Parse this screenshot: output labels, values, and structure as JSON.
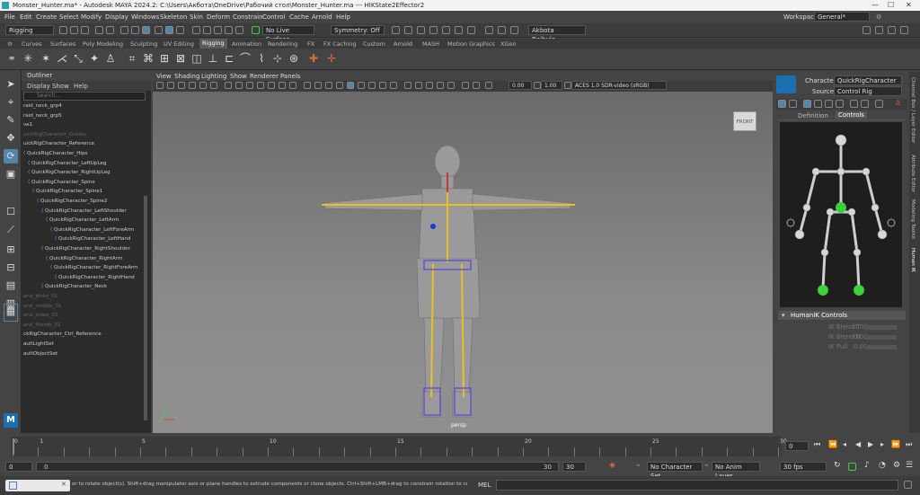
{
  "window": {
    "title": "Monster_Hunter.ma* - Autodesk MAYA 2024.2: C:\\Users\\Акбота\\OneDrive\\Рабочий стол\\Monster_Hunter.ma    ---    HIKState2Effector2"
  },
  "menubar": [
    "File",
    "Edit",
    "Create",
    "Select",
    "Modify",
    "Display",
    "Windows",
    "Skeleton",
    "Skin",
    "Deform",
    "Constrain",
    "Control",
    "Cache",
    "Arnold",
    "Help"
  ],
  "workspace": {
    "label": "Workspace:",
    "value": "General*"
  },
  "statusline": {
    "menuset": "Rigging",
    "live_surface": "No Live Surface",
    "symmetry": "Symmetry: Off",
    "user": "Akbota Baibulo..."
  },
  "shelf_tabs": [
    "Curves",
    "Surfaces",
    "Poly Modeling",
    "Sculpting",
    "UV Editing",
    "Rigging",
    "Animation",
    "Rendering",
    "FX",
    "FX Caching",
    "Custom",
    "Arnold",
    "MASH",
    "Motion Graphics",
    "XGen"
  ],
  "active_shelf_tab": "Rigging",
  "outliner": {
    "title": "Outliner",
    "menu": [
      "Display",
      "Show",
      "Help"
    ],
    "search_placeholder": "Search...",
    "items": [
      {
        "label": "raid_neck_grp4",
        "dim": false,
        "depth": 0
      },
      {
        "label": "raid_neck_grp5",
        "dim": false,
        "depth": 0
      },
      {
        "label": "ve1",
        "dim": false,
        "depth": 0
      },
      {
        "label": "uickRigCharacter_Guides",
        "dim": true,
        "depth": 0
      },
      {
        "label": "uickRigCharacter_Reference",
        "dim": false,
        "depth": 0
      },
      {
        "label": "QuickRigCharacter_Hips",
        "dim": false,
        "depth": 0,
        "joint": true
      },
      {
        "label": "QuickRigCharacter_LeftUpLeg",
        "dim": false,
        "depth": 1,
        "joint": true
      },
      {
        "label": "QuickRigCharacter_RightUpLeg",
        "dim": false,
        "depth": 1,
        "joint": true
      },
      {
        "label": "QuickRigCharacter_Spine",
        "dim": false,
        "depth": 1,
        "joint": true
      },
      {
        "label": "QuickRigCharacter_Spine1",
        "dim": false,
        "depth": 2,
        "joint": true
      },
      {
        "label": "QuickRigCharacter_Spine2",
        "dim": false,
        "depth": 3,
        "joint": true
      },
      {
        "label": "QuickRigCharacter_LeftShoulder",
        "dim": false,
        "depth": 4,
        "joint": true
      },
      {
        "label": "QuickRigCharacter_LeftArm",
        "dim": false,
        "depth": 5,
        "joint": true
      },
      {
        "label": "QuickRigCharacter_LeftForeArm",
        "dim": false,
        "depth": 6,
        "joint": true
      },
      {
        "label": "QuickRigCharacter_LeftHand",
        "dim": false,
        "depth": 7,
        "joint": true
      },
      {
        "label": "QuickRigCharacter_RightShoulder",
        "dim": false,
        "depth": 4,
        "joint": true
      },
      {
        "label": "QuickRigCharacter_RightArm",
        "dim": false,
        "depth": 5,
        "joint": true
      },
      {
        "label": "QuickRigCharacter_RightForeArm",
        "dim": false,
        "depth": 6,
        "joint": true
      },
      {
        "label": "QuickRigCharacter_RightHand",
        "dim": false,
        "depth": 7,
        "joint": true
      },
      {
        "label": "QuickRigCharacter_Neck",
        "dim": false,
        "depth": 4,
        "joint": true
      },
      {
        "label": "and_pinky_01",
        "dim": true,
        "depth": 0
      },
      {
        "label": "and_middle_01",
        "dim": true,
        "depth": 0
      },
      {
        "label": "and_index_01",
        "dim": true,
        "depth": 0
      },
      {
        "label": "and_thumb_01",
        "dim": true,
        "depth": 0
      },
      {
        "label": "ckRigCharacter_Ctrl_Reference",
        "dim": false,
        "depth": 0
      },
      {
        "label": "aultLightSet",
        "dim": false,
        "depth": 0
      },
      {
        "label": "aultObjectSet",
        "dim": false,
        "depth": 0
      }
    ]
  },
  "viewport": {
    "menu": [
      "View",
      "Shading",
      "Lighting",
      "Show",
      "Renderer",
      "Panels"
    ],
    "exposure": "0.00",
    "gamma": "1.00",
    "colorspace": "ACES 1.0 SDR-video (sRGB)",
    "camera_label": "persp",
    "viewcube": "FRONT"
  },
  "hik": {
    "character_label": "Character:",
    "character_value": "QuickRigCharacter",
    "source_label": "Source:",
    "source_value": "Control Rig",
    "tabs": [
      "Definition",
      "Controls"
    ],
    "active_tab": "Controls",
    "section": "HumanIK Controls",
    "props": [
      {
        "label": "IK Blend T",
        "value": "0.00"
      },
      {
        "label": "IK Blend R",
        "value": "0.00"
      },
      {
        "label": "IK Pull",
        "value": "0.00"
      }
    ]
  },
  "side_tabs": [
    "Channel Box / Layer Editor",
    "Attribute Editor",
    "Modeling Toolkit",
    "Human IK"
  ],
  "timeline": {
    "ticks": [
      "0",
      "1",
      "5",
      "10",
      "15",
      "20",
      "25",
      "30"
    ],
    "min": 0,
    "max": 30,
    "current_frame": "0"
  },
  "range": {
    "start": "0",
    "inner_start": "0",
    "inner_end": "30",
    "end": "30",
    "character_set": "No Character Set",
    "anim_layer": "No Anim Layer",
    "fps": "30 fps"
  },
  "cmdline": {
    "help": "or to rotate object(s). Shift+drag manipulator axis or plane handles to extrude components or clone objects. Ctrl+Shift+LMB+drag to constrain rotation to connected edges. Use D or INSE",
    "mel": "MEL"
  },
  "colors": {
    "accent": "#5285a6",
    "joint": "#e8c020",
    "ctrl_green": "#3ad13a",
    "hik_blue": "#1a6fb0"
  }
}
